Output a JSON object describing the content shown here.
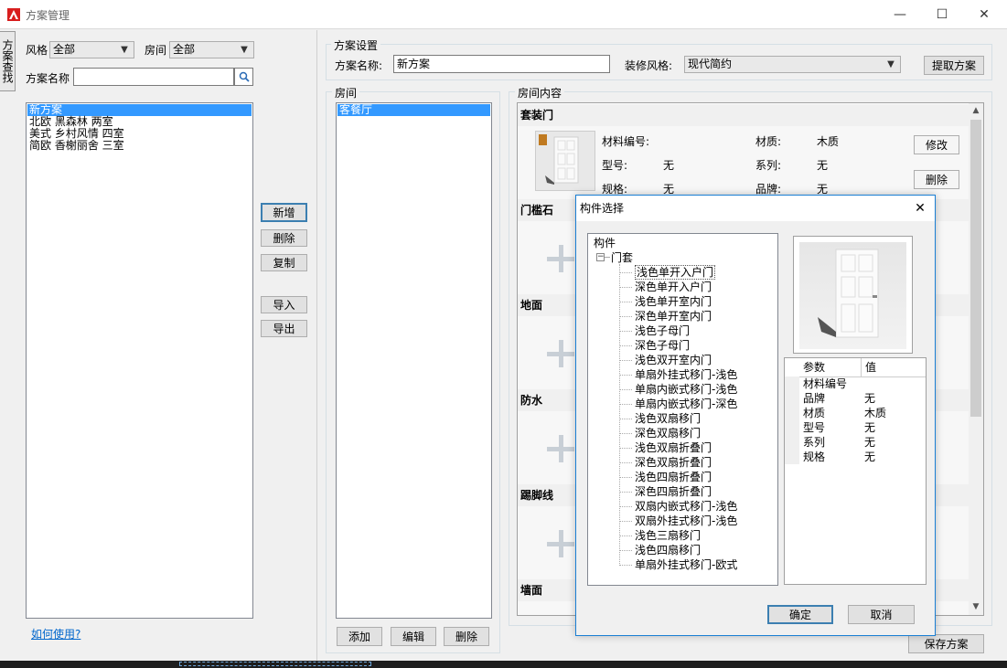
{
  "window": {
    "title": "方案管理",
    "minimize_glyph": "—",
    "maximize_glyph": "☐",
    "close_glyph": "✕"
  },
  "side_tab": {
    "label": "方案查找"
  },
  "filter": {
    "style_label": "风格",
    "style_value": "全部",
    "room_label": "房间",
    "room_value": "全部",
    "name_label": "方案名称",
    "name_value": "",
    "search_icon": "magnifier"
  },
  "plans": {
    "items": [
      "新方案",
      "北欧 黑森林 两室",
      "美式 乡村风情 四室",
      "简欧 香榭丽舍 三室"
    ],
    "selected_index": 0
  },
  "plan_actions": {
    "new": "新增",
    "delete": "删除",
    "copy": "复制",
    "import": "导入",
    "export": "导出"
  },
  "help_link": "如何使用?",
  "settings": {
    "group_title": "方案设置",
    "name_label": "方案名称:",
    "name_value": "新方案",
    "style_label": "装修风格:",
    "style_value": "现代简约",
    "fetch_button": "提取方案"
  },
  "rooms": {
    "group_title": "房间",
    "items": [
      "客餐厅"
    ],
    "selected_index": 0,
    "add": "添加",
    "edit": "编辑",
    "delete": "删除"
  },
  "room_content": {
    "group_title": "房间内容",
    "sections": [
      {
        "title": "套装门"
      },
      {
        "title": "门槛石"
      },
      {
        "title": "地面"
      },
      {
        "title": "防水"
      },
      {
        "title": "踢脚线"
      },
      {
        "title": "墙面"
      }
    ],
    "door": {
      "material_code_label": "材料编号:",
      "material_code_value": "",
      "material_label": "材质:",
      "material_value": "木质",
      "model_label": "型号:",
      "model_value": "无",
      "series_label": "系列:",
      "series_value": "无",
      "spec_label": "规格:",
      "spec_value": "无",
      "brand_label": "品牌:",
      "brand_value": "无",
      "modify_button": "修改",
      "delete_button": "删除"
    }
  },
  "save_button": "保存方案",
  "dialog": {
    "title": "构件选择",
    "close_glyph": "✕",
    "tree_root": "构件",
    "tree_group": "门套",
    "tree_items": [
      "浅色单开入户门",
      "深色单开入户门",
      "浅色单开室内门",
      "深色单开室内门",
      "浅色子母门",
      "深色子母门",
      "浅色双开室内门",
      "单扇外挂式移门-浅色",
      "单扇内嵌式移门-浅色",
      "单扇内嵌式移门-深色",
      "浅色双扇移门",
      "深色双扇移门",
      "浅色双扇折叠门",
      "深色双扇折叠门",
      "浅色四扇折叠门",
      "深色四扇折叠门",
      "双扇内嵌式移门-浅色",
      "双扇外挂式移门-浅色",
      "浅色三扇移门",
      "浅色四扇移门",
      "单扇外挂式移门-欧式"
    ],
    "tree_selected_index": 0,
    "param_header": "参数",
    "value_header": "值",
    "params": [
      {
        "name": "材料编号",
        "value": ""
      },
      {
        "name": "品牌",
        "value": "无"
      },
      {
        "name": "材质",
        "value": "木质"
      },
      {
        "name": "型号",
        "value": "无"
      },
      {
        "name": "系列",
        "value": "无"
      },
      {
        "name": "规格",
        "value": "无"
      }
    ],
    "ok": "确定",
    "cancel": "取消"
  },
  "colors": {
    "accent": "#3399ff",
    "dialog_border": "#1a7fd4",
    "app_icon": "#d81e1e"
  }
}
